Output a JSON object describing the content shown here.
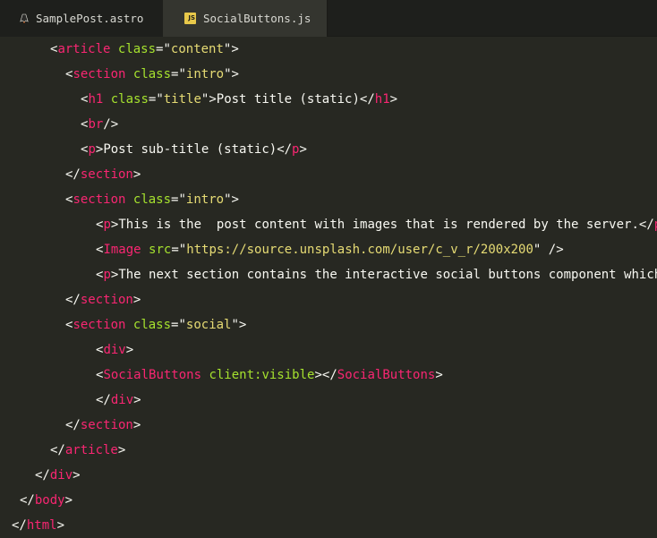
{
  "tabs": [
    {
      "label": "SamplePost.astro",
      "icon": "astro-icon",
      "active": false
    },
    {
      "label": "SocialButtons.js",
      "icon": "js-icon",
      "icon_text": "JS",
      "active": true
    }
  ],
  "colors": {
    "background": "#272822",
    "tag": "#f92672",
    "attribute": "#a6e22e",
    "string": "#e6db74",
    "text": "#f8f8f2"
  },
  "code": {
    "l1": [
      "<",
      "article",
      " ",
      "class",
      "=\"",
      "content",
      "\">"
    ],
    "l2": [
      "<",
      "section",
      " ",
      "class",
      "=\"",
      "intro",
      "\">"
    ],
    "l3": [
      "<",
      "h1",
      " ",
      "class",
      "=\"",
      "title",
      "\">",
      "Post title (static)",
      "</",
      "h1",
      ">"
    ],
    "l4": [
      "<",
      "br",
      "/>"
    ],
    "l5": [
      "<",
      "p",
      ">",
      "Post sub-title (static)",
      "</",
      "p",
      ">"
    ],
    "l6": [
      "</",
      "section",
      ">"
    ],
    "l7": [
      "<",
      "section",
      " ",
      "class",
      "=\"",
      "intro",
      "\">"
    ],
    "l8": [
      "<",
      "p",
      ">",
      "This is the  post content with images that is rendered by the server.",
      "</",
      "p"
    ],
    "l9": [
      "<",
      "Image",
      " ",
      "src",
      "=\"",
      "https://source.unsplash.com/user/c_v_r/200x200",
      "\" />"
    ],
    "l10": [
      "<",
      "p",
      ">",
      "The next section contains the interactive social buttons component which"
    ],
    "l11": [
      "</",
      "section",
      ">"
    ],
    "l12": [
      "<",
      "section",
      " ",
      "class",
      "=\"",
      "social",
      "\">"
    ],
    "l13": [
      "<",
      "div",
      ">"
    ],
    "l14": [
      "<",
      "SocialButtons",
      " ",
      "client:visible",
      "></",
      "SocialButtons",
      ">"
    ],
    "l15": [
      "</",
      "div",
      ">"
    ],
    "l16": [
      "</",
      "section",
      ">"
    ],
    "l17": [
      "</",
      "article",
      ">"
    ],
    "l18": [
      "</",
      "div",
      ">"
    ],
    "l19": [
      "</",
      "body",
      ">"
    ],
    "l20": [
      "</",
      "html",
      ">"
    ]
  }
}
